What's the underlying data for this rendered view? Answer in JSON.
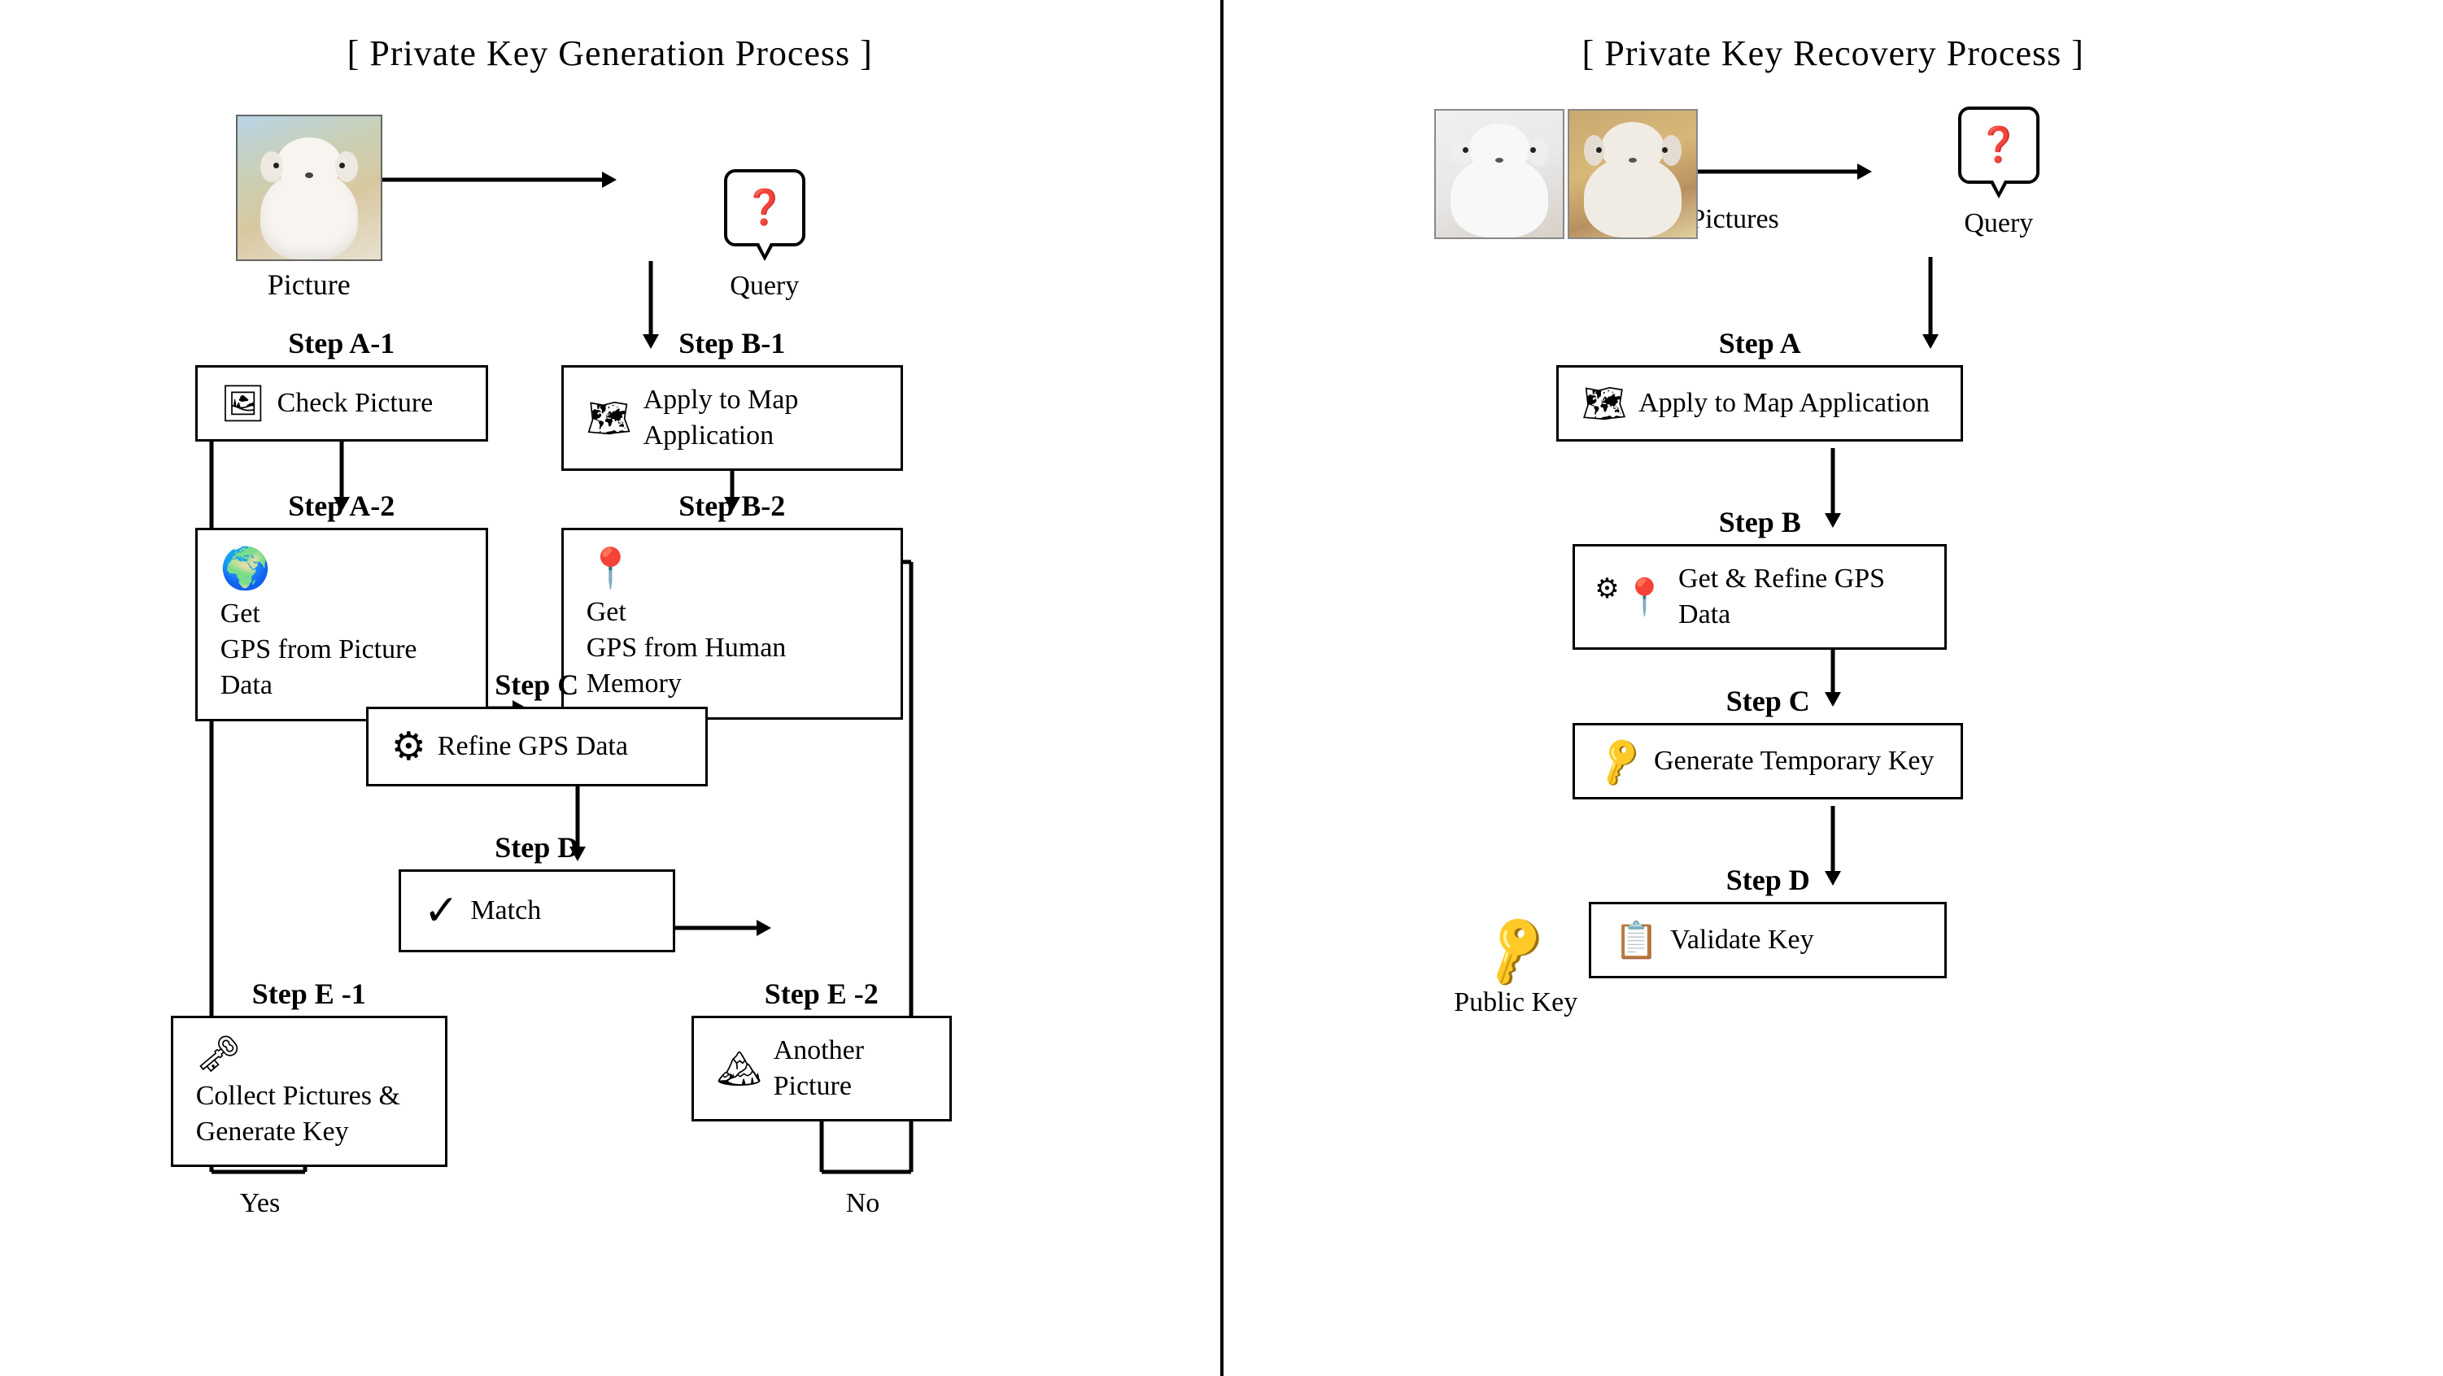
{
  "left": {
    "title": "[ Private Key Generation Process ]",
    "picture_label": "Picture",
    "query_label": "Query",
    "step_a1_label": "Step A-1",
    "step_a1_text": "Check Picture",
    "step_a2_label": "Step A-2",
    "step_a2_text": "Get\nGPS from Picture Data",
    "step_b1_label": "Step B-1",
    "step_b1_text": "Apply to Map Application",
    "step_b2_label": "Step B-2",
    "step_b2_text": "Get\nGPS from Human Memory",
    "step_c_label": "Step C",
    "step_c_text": "Refine GPS Data",
    "step_d_label": "Step D",
    "step_d_text": "Match",
    "step_e1_label": "Step E -1",
    "step_e1_text": "Collect Pictures &\nGenerate Key",
    "step_e2_label": "Step E -2",
    "step_e2_text": "Another Picture",
    "yes_label": "Yes",
    "no_label": "No"
  },
  "right": {
    "title": "[ Private Key Recovery Process ]",
    "pictures_label": "Pictures",
    "query_label": "Query",
    "step_a_label": "Step A",
    "step_a_text": "Apply to Map Application",
    "step_b_label": "Step B",
    "step_b_text": "Get & Refine GPS Data",
    "step_c_label": "Step C",
    "step_c_text": "Generate Temporary Key",
    "step_d_label": "Step D",
    "step_d_text": "Validate Key",
    "public_key_label": "Public Key"
  }
}
